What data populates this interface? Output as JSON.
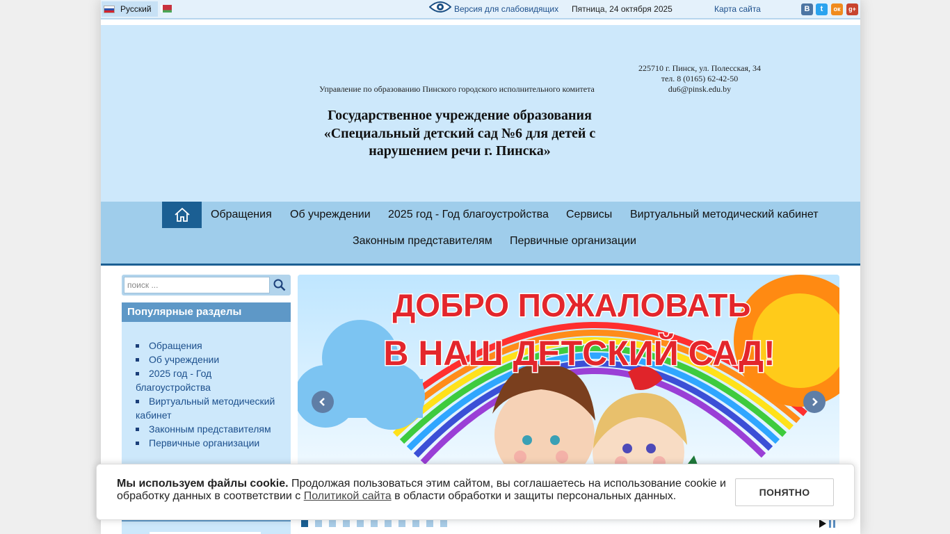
{
  "topbar": {
    "language_current": "Русский",
    "low_vision_link": "Версия для слабовидящих",
    "date": "Пятница, 24 октября 2025",
    "sitemap_link": "Карта сайта",
    "social": [
      {
        "name": "vkontakte",
        "glyph": "В",
        "color": "#4c75a3"
      },
      {
        "name": "twitter",
        "glyph": "t",
        "color": "#2aa3ef"
      },
      {
        "name": "odnoklassniki",
        "glyph": "ок",
        "color": "#f08b1d"
      },
      {
        "name": "google-plus",
        "glyph": "g+",
        "color": "#c8452f"
      }
    ]
  },
  "header": {
    "subordinate": "Управление по образованию Пинского городского исполнительного комитета",
    "address_line1": "225710 г. Пинск, ул. Полесская, 34",
    "address_line2": "тел. 8 (0165) 62-42-50",
    "address_line3": "du6@pinsk.edu.by",
    "title_line1": "Государственное учреждение образования",
    "title_line2": "«Специальный детский сад №6 для детей с",
    "title_line3": "нарушением речи г. Пинска»"
  },
  "nav": {
    "items": [
      "Обращения",
      "Об учреждении",
      "2025 год - Год благоустройства",
      "Сервисы",
      "Виртуальный методический кабинет",
      "Законным представителям",
      "Первичные организации"
    ]
  },
  "search": {
    "placeholder": "поиск ..."
  },
  "popular": {
    "title": "Популярные разделы",
    "items": [
      "Обращения",
      "Об учреждении",
      "2025 год - Год благоустройства",
      "Виртуальный методический кабинет",
      "Законным представителям",
      "Первичные организации"
    ]
  },
  "slider": {
    "banner_line1": "ДОБРО ПОЖАЛОВАТЬ",
    "banner_line2": "В НАШ ДЕТСКИЙ САД!",
    "slide_count": 11,
    "active_slide": 1
  },
  "cookie": {
    "bold": "Мы используем файлы cookie.",
    "text_before_link": " Продолжая пользоваться этим сайтом, вы соглашаетесь на использование cookie и обработку данных в соответствии с ",
    "link": "Политикой сайта",
    "text_after_link": " в области обработки и защиты персональных данных.",
    "button": "ПОНЯТНО"
  }
}
